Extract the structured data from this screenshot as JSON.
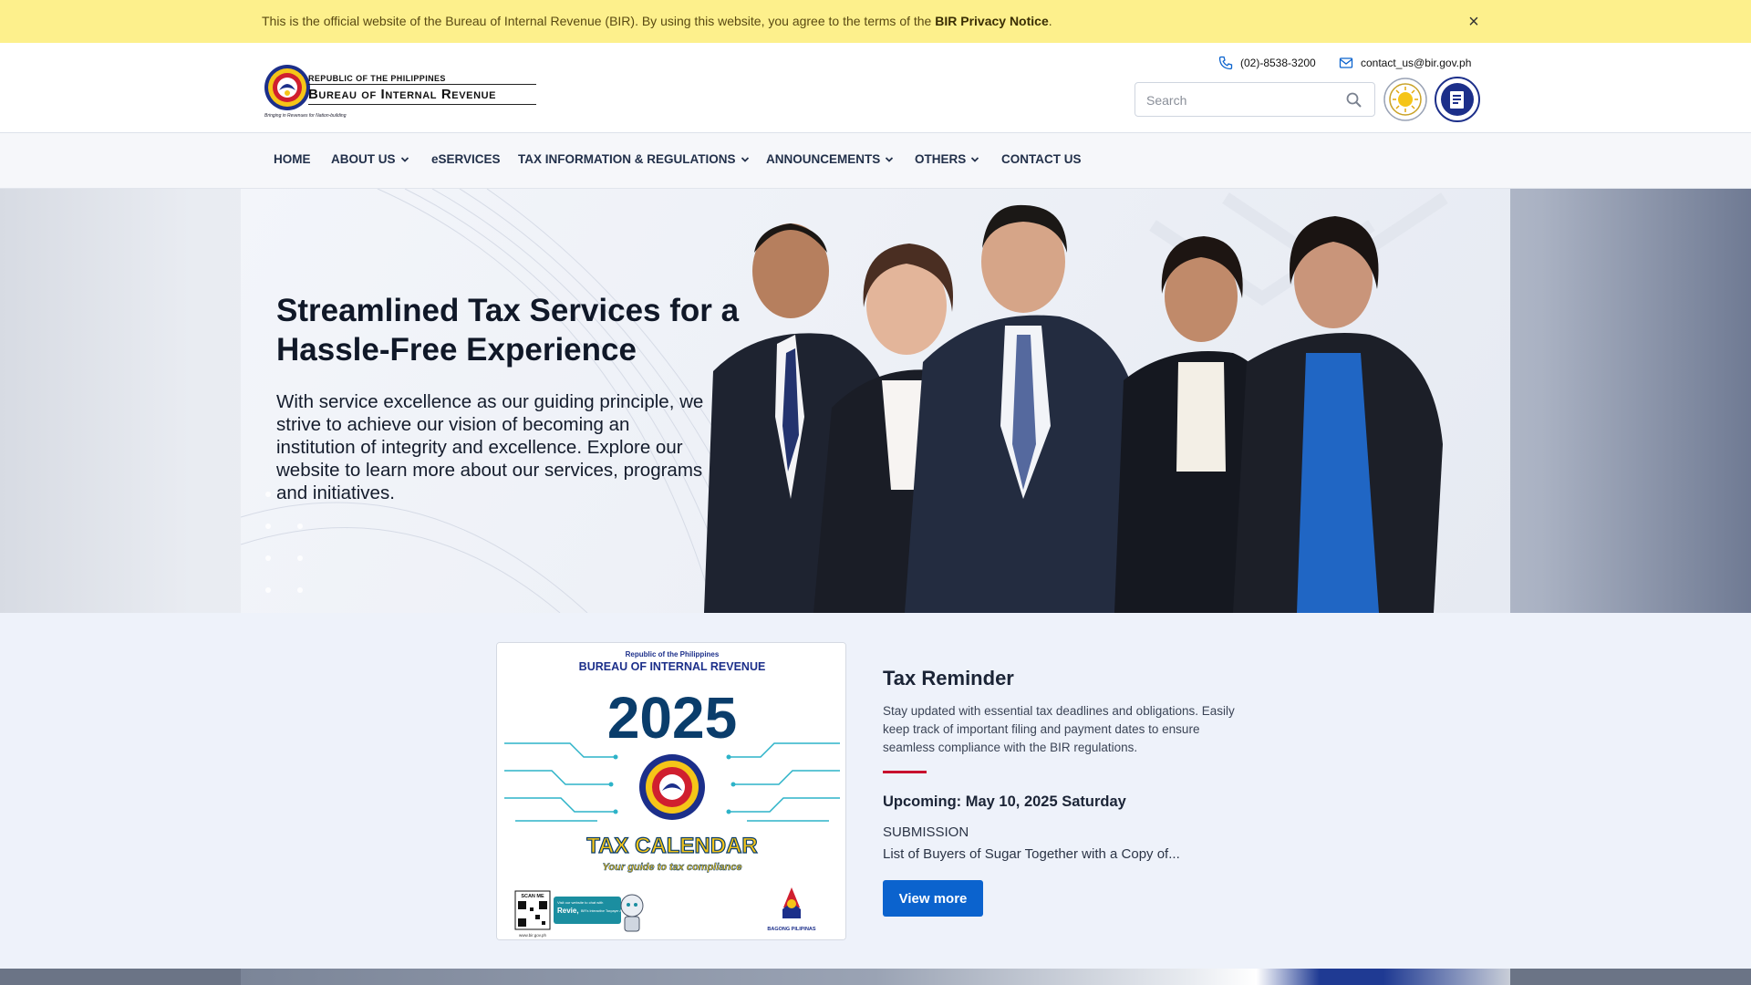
{
  "notice": {
    "text": "This is the official website of the Bureau of Internal Revenue (BIR). By using this website, you agree to the terms of the ",
    "link": "BIR Privacy Notice",
    "end": ".",
    "close": "×"
  },
  "header": {
    "brand_top": "Republic of the Philippines",
    "brand_main": "Bureau of Internal Revenue",
    "logo_tagline": "Bringing in Revenues for Nation-building",
    "phone": "(02)-8538-3200",
    "email": "contact_us@bir.gov.ph",
    "search_placeholder": "Search"
  },
  "nav": {
    "items": [
      {
        "label": "HOME",
        "dropdown": false
      },
      {
        "label": "ABOUT US",
        "dropdown": true
      },
      {
        "label": "eSERVICES",
        "dropdown": false
      },
      {
        "label": "TAX INFORMATION & REGULATIONS",
        "dropdown": true
      },
      {
        "label": "ANNOUNCEMENTS",
        "dropdown": true
      },
      {
        "label": "OTHERS",
        "dropdown": true
      },
      {
        "label": "CONTACT US",
        "dropdown": false
      }
    ]
  },
  "hero": {
    "title": "Streamlined Tax Services for a Hassle-Free Experience",
    "body": "With service excellence as our guiding principle, we strive to achieve our vision of becoming an institution of integrity and excellence. Explore our website to learn more about our services, programs and initiatives."
  },
  "calendar_card": {
    "top": "Republic of the Philippines",
    "bureau": "BUREAU OF INTERNAL REVENUE",
    "year": "2025",
    "title": "TAX CALENDAR",
    "tagline": "Your guide to tax compliance",
    "scan": "SCAN ME",
    "chat": "Visit our website to chat with",
    "revie": "Revie,",
    "revie_sub": "BIR's Interactive Taxpayer Assistant",
    "url": "www.bir.gov.ph",
    "bagong": "BAGONG PILIPINAS"
  },
  "tax_reminder": {
    "title": "Tax Reminder",
    "description": "Stay updated with essential tax deadlines and obligations. Easily keep track of important filing and payment dates to ensure seamless compliance with the BIR regulations.",
    "upcoming": "Upcoming: May 10, 2025 Saturday",
    "type": "SUBMISSION",
    "item": "List of Buyers of Sugar Together with a Copy of...",
    "button": "View more"
  },
  "colors": {
    "notice_bg": "#fdf08c",
    "accent_blue": "#0b63ce",
    "accent_red": "#c8102e",
    "nav_text": "#22304a"
  }
}
